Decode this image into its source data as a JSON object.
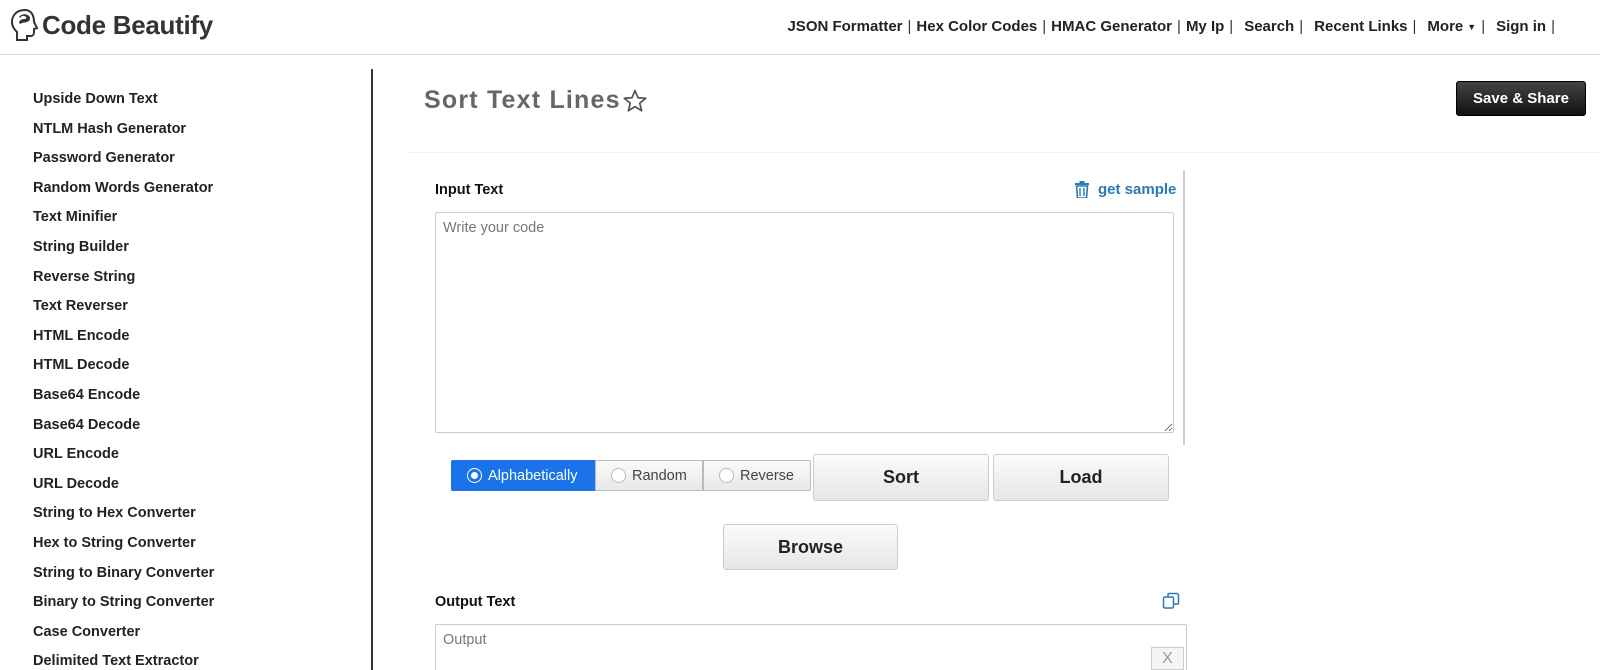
{
  "header": {
    "logo_text": "Code Beautify",
    "nav": [
      "JSON Formatter",
      "Hex Color Codes",
      "HMAC Generator",
      "My Ip",
      "Search",
      "Recent Links",
      "More",
      "Sign in"
    ],
    "separator": "|"
  },
  "sidebar": {
    "items": [
      "Upside Down Text",
      "NTLM Hash Generator",
      "Password Generator",
      "Random Words Generator",
      "Text Minifier",
      "String Builder",
      "Reverse String",
      "Text Reverser",
      "HTML Encode",
      "HTML Decode",
      "Base64 Encode",
      "Base64 Decode",
      "URL Encode",
      "URL Decode",
      "String to Hex Converter",
      "Hex to String Converter",
      "String to Binary Converter",
      "Binary to String Converter",
      "Case Converter",
      "Delimited Text Extractor"
    ]
  },
  "main": {
    "title": "Sort Text Lines",
    "save_share_label": "Save & Share",
    "input_label": "Input Text",
    "get_sample_label": "get sample",
    "input_placeholder": "Write your code",
    "sort_options": [
      "Alphabetically",
      "Random",
      "Reverse"
    ],
    "selected_sort_option": "Alphabetically",
    "sort_button_label": "Sort",
    "load_button_label": "Load",
    "browse_button_label": "Browse",
    "output_label": "Output Text",
    "output_placeholder": "Output",
    "clear_label": "X"
  },
  "colors": {
    "accent": "#1a73e8",
    "link": "#2a7ab8",
    "save_button": "#222222"
  },
  "icons": {
    "logo": "code-beautify-logo",
    "star": "star-outline-icon",
    "trash": "trash-icon",
    "copy": "copy-icon"
  }
}
